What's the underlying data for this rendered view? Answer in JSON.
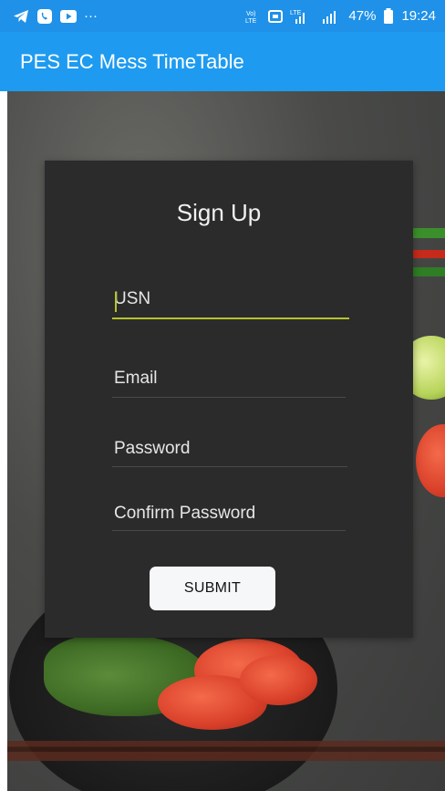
{
  "status_bar": {
    "left_icons": [
      "telegram-icon",
      "viber-icon",
      "youtube-icon",
      "more-dots-icon"
    ],
    "more": "···",
    "volte": "Vo)\nLTE",
    "lte": "LTE",
    "battery_percent": "47%",
    "time": "19:24"
  },
  "app_bar": {
    "title": "PES EC Mess TimeTable"
  },
  "signup": {
    "title": "Sign Up",
    "fields": {
      "usn": {
        "placeholder": "USN",
        "value": ""
      },
      "email": {
        "placeholder": "Email",
        "value": ""
      },
      "password": {
        "placeholder": "Password",
        "value": ""
      },
      "confirm_password": {
        "placeholder": "Confirm Password",
        "value": ""
      }
    },
    "submit_label": "SUBMIT",
    "focused_field": "usn"
  },
  "colors": {
    "status_bar": "#1f91e8",
    "app_bar": "#1e9bf0",
    "card_bg": "#2b2b2b",
    "focus_accent": "#b5c42a",
    "button_bg": "#f6f7f9"
  }
}
